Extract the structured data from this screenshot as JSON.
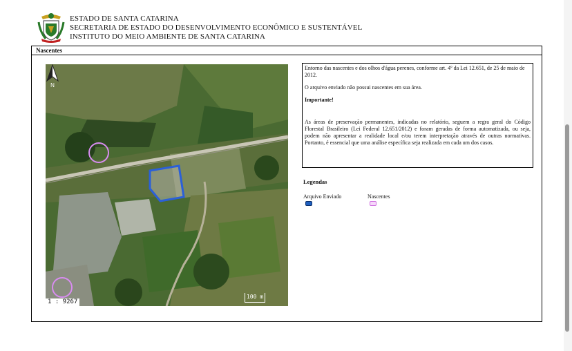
{
  "header": {
    "line1": "ESTADO DE SANTA CATARINA",
    "line2": "SECRETARIA DE ESTADO DO DESENVOLVIMENTO ECONÔMICO E SUSTENTÁVEL",
    "line3": "INSTITUTO DO MEIO AMBIENTE DE SANTA CATARINA",
    "seal_icon": "coat-of-arms-icon"
  },
  "section": {
    "title": "Nascentes"
  },
  "map": {
    "scale_ratio": "1 : 9267",
    "scale_bar_label": "100 m",
    "north_icon": "north-arrow-icon"
  },
  "info": {
    "intro": "Entorno das nascentes e dos olhos d'água perenes, conforme art. 4º da Lei 12.651, de 25 de maio de 2012.",
    "result": "O arquivo enviado não possui nascentes em sua área.",
    "important_label": "Importante!",
    "body": "As áreas de preservação permanentes, indicadas no relatório, seguem a regra geral do Código Florestal Brasileiro (Lei Federal 12.651/2012) e foram geradas de forma automatizada, ou seja, podem não apresentar a realidade local e/ou terem interpretação através de outras normativas. Portanto, é essencial que uma análise específica seja realizada em cada um dos casos."
  },
  "legend": {
    "title": "Legendas",
    "items": [
      {
        "label": "Arquivo Enviado",
        "color": "#1f5fbf"
      },
      {
        "label": "Nascentes",
        "color": "#d070e0"
      }
    ]
  },
  "colors": {
    "polygon": "#2b60d8",
    "spring_circle": "#d88cf0"
  }
}
